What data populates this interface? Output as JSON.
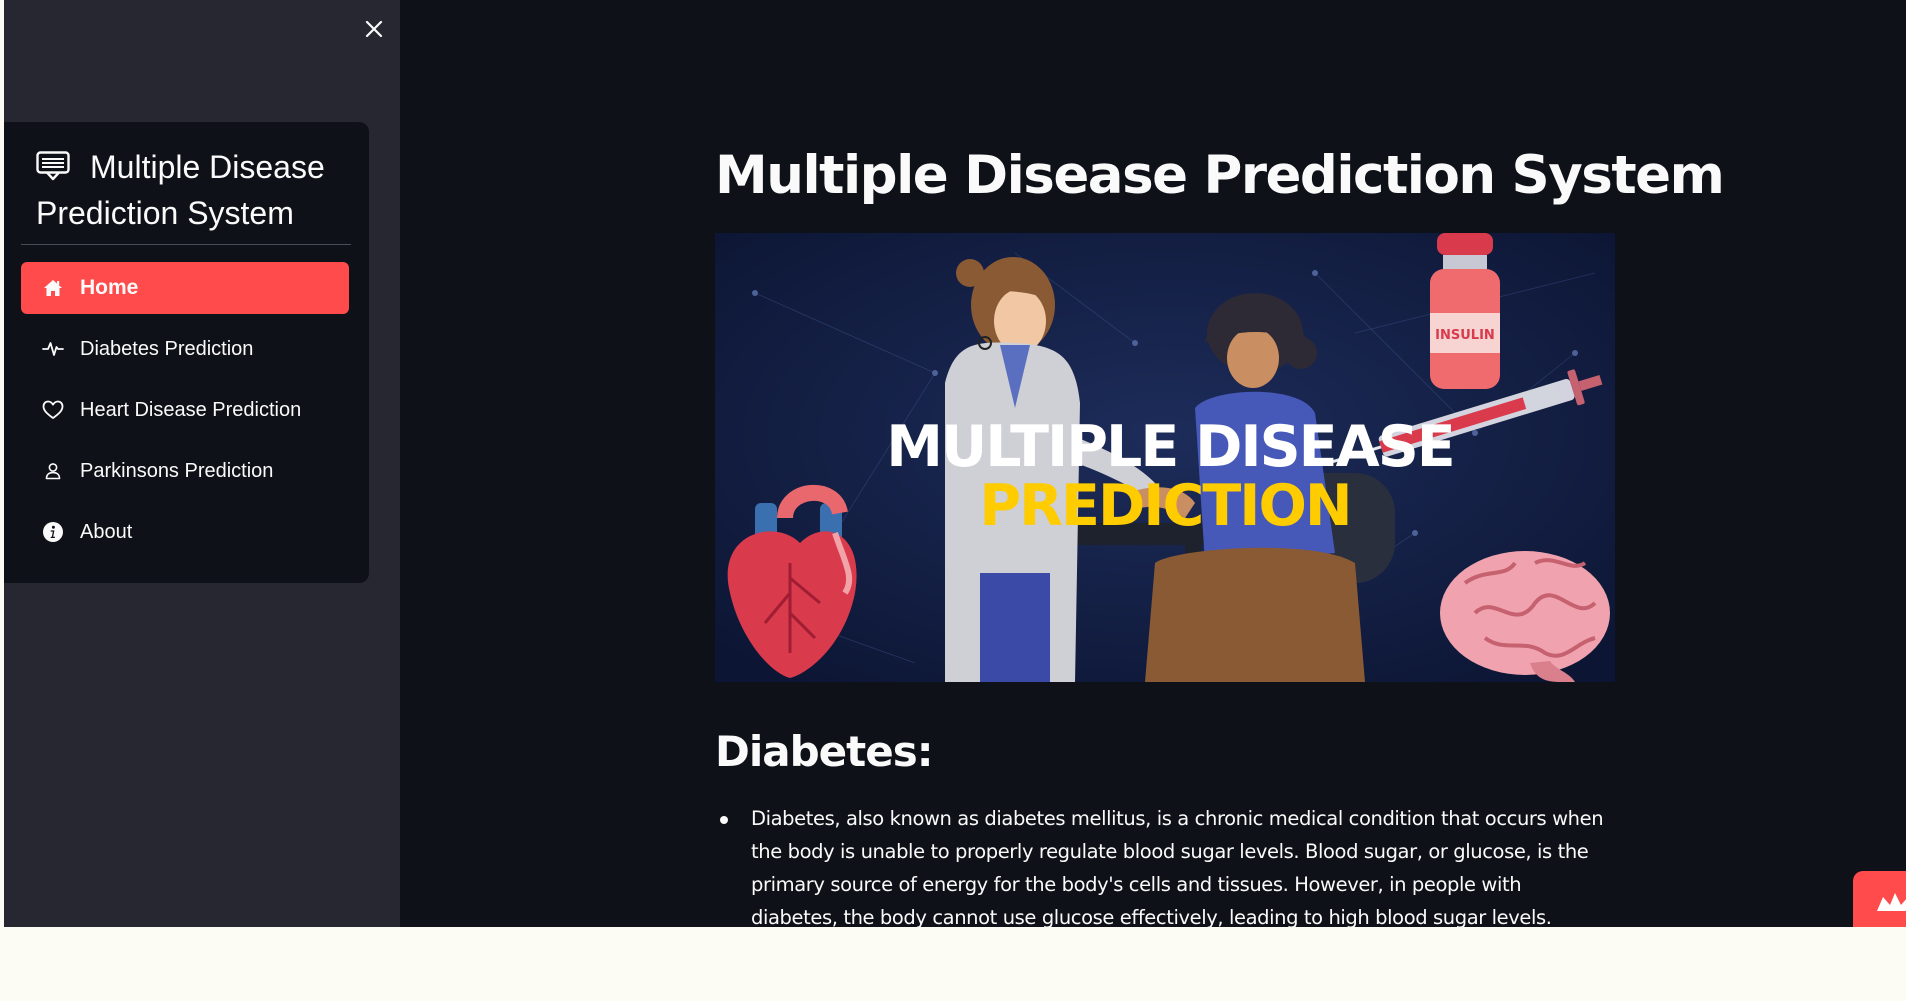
{
  "sidebar": {
    "close_label": "×",
    "menu_title": "Multiple Disease Prediction System",
    "items": [
      {
        "label": "Home",
        "icon": "house-icon",
        "active": true
      },
      {
        "label": "Diabetes Prediction",
        "icon": "activity-icon",
        "active": false
      },
      {
        "label": "Heart Disease Prediction",
        "icon": "heart-icon",
        "active": false
      },
      {
        "label": "Parkinsons Prediction",
        "icon": "person-icon",
        "active": false
      },
      {
        "label": "About",
        "icon": "info-icon",
        "active": false
      }
    ]
  },
  "main": {
    "title": "Multiple Disease Prediction System",
    "banner": {
      "line1": "MULTIPLE DISEASE",
      "line2": "PREDICTION",
      "vial_label": "INSULIN"
    },
    "section_title": "Diabetes:",
    "bullets": [
      "Diabetes, also known as diabetes mellitus, is a chronic medical condition that occurs when the body is unable to properly regulate blood sugar levels. Blood sugar, or glucose, is the primary source of energy for the body's cells and tissues. However, in people with diabetes, the body cannot use glucose effectively, leading to high blood sugar levels."
    ]
  },
  "colors": {
    "accent": "#ff4b4b",
    "background": "#0e1117",
    "sidebar": "#262730",
    "text": "#fafafa",
    "banner_highlight": "#ffcc00"
  }
}
